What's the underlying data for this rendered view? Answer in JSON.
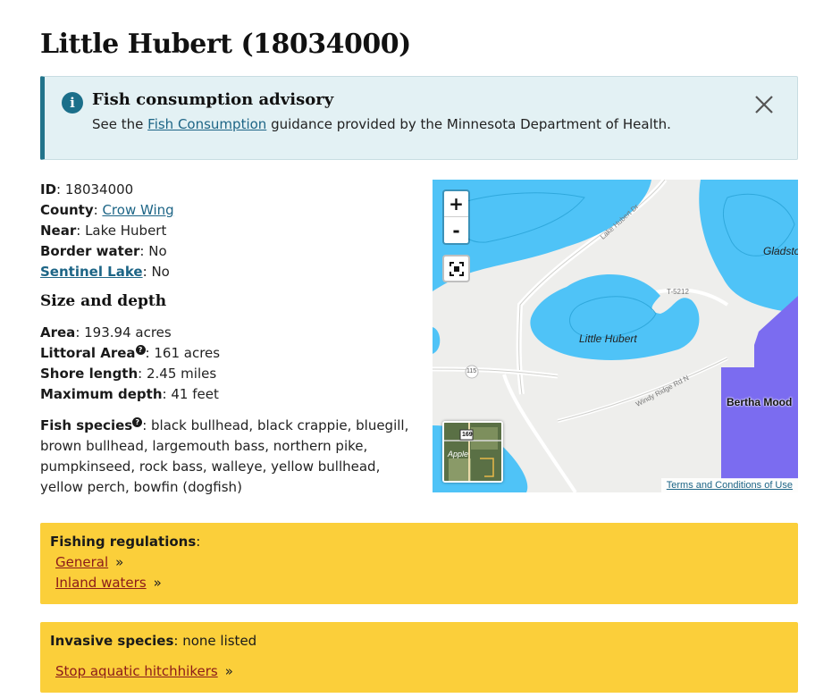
{
  "page": {
    "title": "Little Hubert (18034000)"
  },
  "advisory": {
    "title": "Fish consumption advisory",
    "body_prefix": "See the",
    "link_text": "Fish Consumption",
    "body_suffix": "guidance provided by the Minnesota Department of Health.",
    "info_icon": "info-icon",
    "close_icon": "close-icon"
  },
  "facts": {
    "id_label": "ID",
    "id_value": "18034000",
    "county_label": "County",
    "county_value": "Crow Wing",
    "near_label": "Near",
    "near_value": "Lake Hubert",
    "border_label": "Border water",
    "border_value": "No",
    "sentinel_label": "Sentinel Lake",
    "sentinel_value": "No"
  },
  "size_depth": {
    "heading": "Size and depth",
    "area_label": "Area",
    "area_value": "193.94 acres",
    "littoral_label": "Littoral Area",
    "littoral_value": "161 acres",
    "shore_label": "Shore length",
    "shore_value": "2.45 miles",
    "depth_label": "Maximum depth",
    "depth_value": "41 feet"
  },
  "fish": {
    "label": "Fish species",
    "value": "black bullhead, black crappie, bluegill, brown bullhead, largemouth bass, northern pike, pumpkinseed, rock bass, walleye, yellow bullhead, yellow perch, bowfin (dogfish)"
  },
  "map": {
    "zoom_in": "+",
    "zoom_out": "-",
    "fullscreen_icon": "fullscreen-icon",
    "terms": "Terms and Conditions of Use",
    "labels": {
      "lake": "Little Hubert",
      "road1": "Lake Hubert Dr",
      "road2": "T-5212",
      "road3": "Windy Ridge Rd N",
      "hwy": "115",
      "gladstone": "Gladsto",
      "bertha": "Bertha Mood"
    },
    "minimap": {
      "hwy": "169",
      "label": "Apple"
    },
    "colors": {
      "water": "#4fc3f7",
      "land": "#eeeeec",
      "protected": "#7b6cf0"
    }
  },
  "regulations": {
    "label": "Fishing regulations",
    "links": [
      {
        "text": "General"
      },
      {
        "text": "Inland waters"
      }
    ],
    "raquo": "»"
  },
  "invasive": {
    "label": "Invasive species",
    "value": "none listed",
    "link": "Stop aquatic hitchhikers",
    "raquo": "»"
  }
}
